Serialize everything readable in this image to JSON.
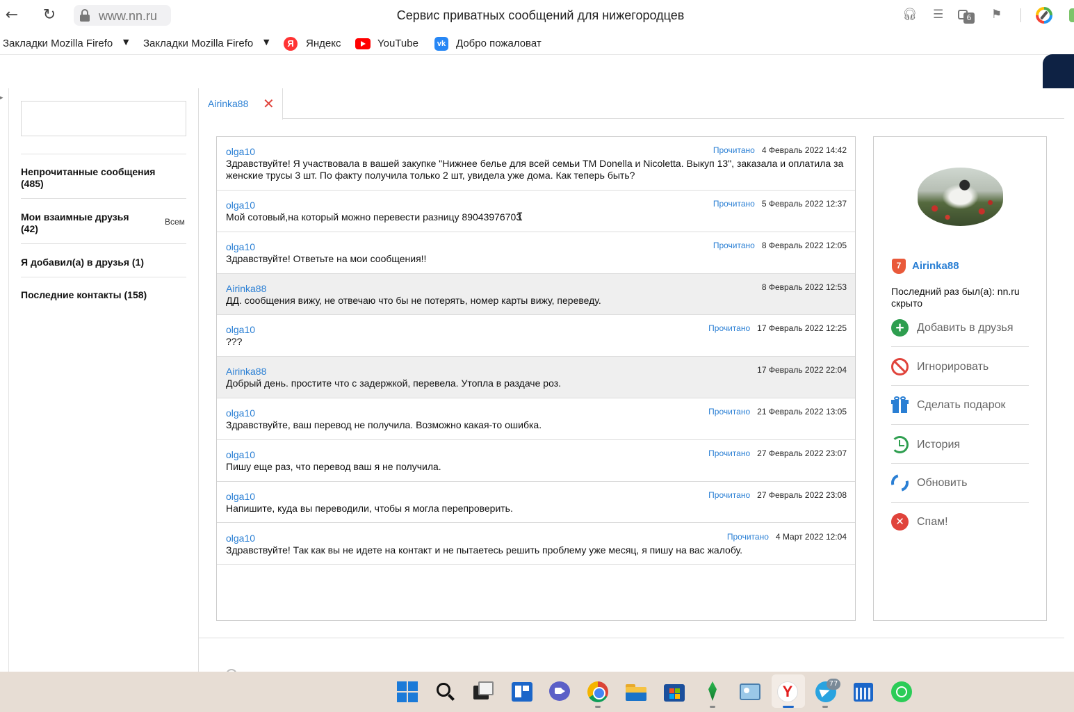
{
  "browser": {
    "url": "www.nn.ru",
    "title": "Сервис приватных сообщений для нижегородцев",
    "tab_count": "6",
    "bookmarks": [
      {
        "label": "Закладки Mozilla Firefo"
      },
      {
        "label": "Закладки Mozilla Firefo"
      },
      {
        "label": "Яндекс"
      },
      {
        "label": "YouTube"
      },
      {
        "label": "Добро пожаловат"
      }
    ]
  },
  "sidebar": {
    "items": [
      {
        "label": "Непрочитанные сообщения (485)"
      },
      {
        "label": "Мои взаимные друзья (42)"
      },
      {
        "label": "Я добавил(а) в друзья (1)"
      },
      {
        "label": "Последние контакты (158)"
      }
    ],
    "all_link": "Всем"
  },
  "conversation_tab": {
    "label": "Airinka88"
  },
  "messages": [
    {
      "author": "olga10",
      "status": "Прочитано",
      "date": "4 Февраль 2022 14:42",
      "text": "Здравствуйте! Я участвовала в вашей закупке \"Нижнее белье для всей семьи TM Donella и Nicoletta. Выкуп 13\", заказала и оплатила за женские трусы 3 шт. По факту получила только 2 шт, увидела уже дома. Как теперь быть?"
    },
    {
      "author": "olga10",
      "status": "Прочитано",
      "date": "5 Февраль 2022 12:37",
      "text": "Мой сотовый,на который можно перевести разницу 89043976703"
    },
    {
      "author": "olga10",
      "status": "Прочитано",
      "date": "8 Февраль 2022 12:05",
      "text": "Здравствуйте! Ответьте на мои сообщения!!"
    },
    {
      "author": "Airinka88",
      "status": "",
      "date": "8 Февраль 2022 12:53",
      "text": "ДД. сообщения вижу, не отвечаю что бы не потерять, номер карты вижу, переведу."
    },
    {
      "author": "olga10",
      "status": "Прочитано",
      "date": "17 Февраль 2022 12:25",
      "text": "???"
    },
    {
      "author": "Airinka88",
      "status": "",
      "date": "17 Февраль 2022 22:04",
      "text": "Добрый день. простите что с задержкой, перевела. Утопла в раздаче роз."
    },
    {
      "author": "olga10",
      "status": "Прочитано",
      "date": "21 Февраль 2022 13:05",
      "text": "Здравствуйте, ваш перевод не получила. Возможно какая-то ошибка."
    },
    {
      "author": "olga10",
      "status": "Прочитано",
      "date": "27 Февраль 2022 23:07",
      "text": "Пишу еще раз, что перевод ваш я не получила."
    },
    {
      "author": "olga10",
      "status": "Прочитано",
      "date": "27 Февраль 2022 23:08",
      "text": "Напишите, куда вы переводили, чтобы я могла перепроверить."
    },
    {
      "author": "olga10",
      "status": "Прочитано",
      "date": "4 Март 2022 12:04",
      "text": "Здравствуйте! Так как вы не идете на контакт и не пытаетесь решить проблему уже месяц, я пишу на вас жалобу."
    }
  ],
  "profile": {
    "level": "7",
    "username": "Airinka88",
    "last_seen": "Последний раз был(а): nn.ru скрыто",
    "actions": [
      {
        "label": "Добавить в друзья",
        "icon": "add-friend-icon"
      },
      {
        "label": "Игнорировать",
        "icon": "block-icon"
      },
      {
        "label": "Сделать подарок",
        "icon": "gift-icon"
      },
      {
        "label": "История",
        "icon": "history-icon"
      },
      {
        "label": "Обновить",
        "icon": "refresh-icon"
      },
      {
        "label": "Спам!",
        "icon": "spam-icon"
      }
    ]
  },
  "taskbar": {
    "telegram_badge": "77"
  },
  "colors": {
    "link": "#2a7fd4",
    "danger": "#e0433b",
    "success": "#2e9e4f",
    "alt_row": "#efefef"
  }
}
